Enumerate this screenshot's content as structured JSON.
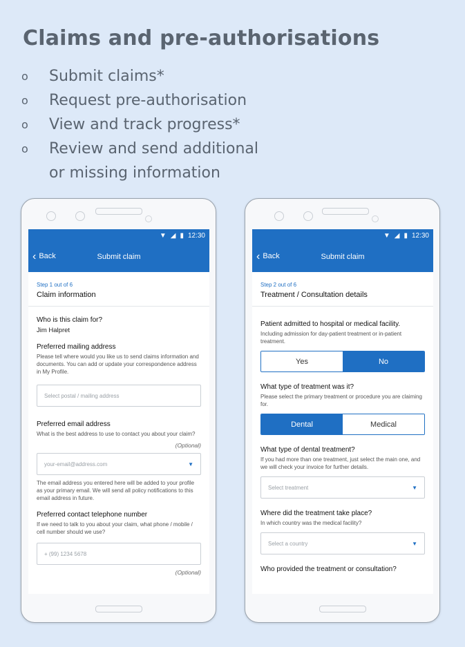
{
  "headline": "Claims and pre-authorisations",
  "bullets": [
    {
      "marker": "o",
      "text": "Submit claims*"
    },
    {
      "marker": "o",
      "text": "Request pre-authorisation"
    },
    {
      "marker": "o",
      "text": "View and track progress*"
    },
    {
      "marker": "o",
      "text": "Review and send additional"
    }
  ],
  "bullet_continuation": "or missing information",
  "colors": {
    "accent": "#1f6fc3",
    "background": "#dde9f8",
    "heading": "#5a6470"
  },
  "phone1": {
    "status_time": "12:30",
    "back_label": "Back",
    "title": "Submit claim",
    "step": "Step 1 out of 6",
    "section": "Claim information",
    "who_label": "Who is this claim for?",
    "who_value": "Jim Halpret",
    "mailing_label": "Preferred mailing address",
    "mailing_help": "Please tell where would you like us to send claims information and documents. You can add or update your correspondence address in My Profile.",
    "mailing_placeholder": "Select postal / mailing address",
    "email_label": "Preferred email address",
    "email_help": "What is the best address to use to contact you about your claim?",
    "optional": "(Optional)",
    "email_placeholder": "your-email@address.com",
    "email_note": "The email address you entered here will be added to your profile as your primary email. We will send all policy notifications to this email address in future.",
    "phone_label": "Preferred contact telephone number",
    "phone_help": "If we need to talk to you about your claim, what phone / mobile / cell number should we use?",
    "phone_placeholder": "+ (99) 1234 5678"
  },
  "phone2": {
    "status_time": "12:30",
    "back_label": "Back",
    "title": "Submit claim",
    "step": "Step 2 out of 6",
    "section": "Treatment / Consultation details",
    "admitted_label": "Patient admitted to hospital or medical facility.",
    "admitted_help": "Including admission for day-patient treatment or in-patient treatment.",
    "yes": "Yes",
    "no": "No",
    "type_label": "What type of treatment was it?",
    "type_help": "Please select the primary treatment or procedure you are claiming for.",
    "dental": "Dental",
    "medical": "Medical",
    "dental_type_label": "What type of dental treatment?",
    "dental_type_help": "If you had more than one treatment, just select the main one, and we will check your invoice for further details.",
    "treatment_placeholder": "Select treatment",
    "where_label": "Where did the treatment take place?",
    "where_help": "In which country was the medical facility?",
    "country_placeholder": "Select a country",
    "who_provided_label": "Who provided the treatment or consultation?"
  }
}
